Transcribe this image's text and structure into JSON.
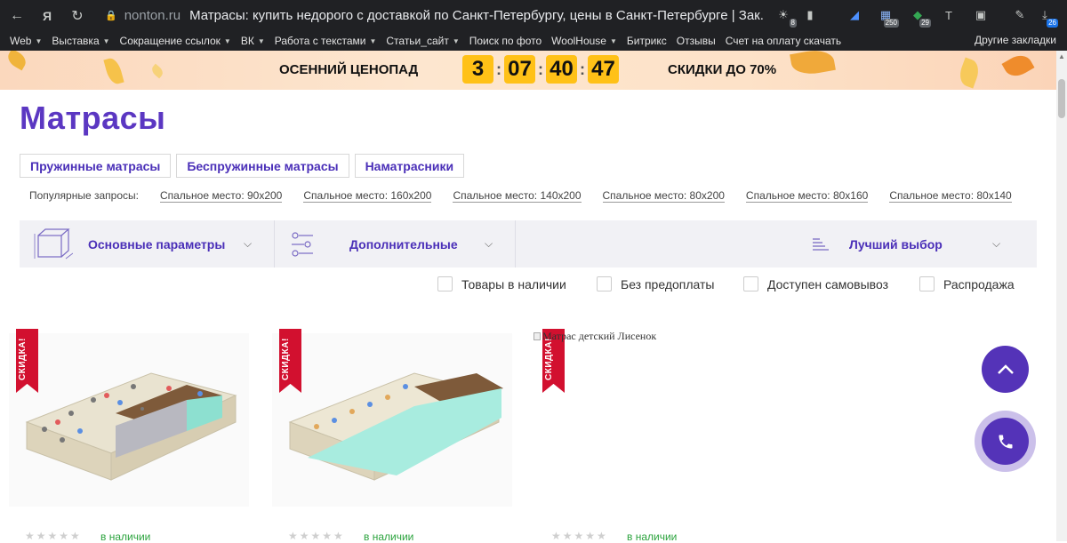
{
  "browser": {
    "domain": "nonton.ru",
    "tab_title": "Матрасы: купить недорого с доставкой по Санкт-Петербургу, цены в Санкт-Петербурге | Зак...",
    "extension_badges": [
      "8",
      "250",
      "29",
      "26"
    ]
  },
  "bookmarks": {
    "items": [
      {
        "label": "Web",
        "dropdown": true
      },
      {
        "label": "Выставка",
        "dropdown": true
      },
      {
        "label": "Сокращение ссылок",
        "dropdown": true
      },
      {
        "label": "ВК",
        "dropdown": true
      },
      {
        "label": "Работа с текстами",
        "dropdown": true
      },
      {
        "label": "Статьи_сайт",
        "dropdown": true
      },
      {
        "label": "Поиск по фото",
        "dropdown": false
      },
      {
        "label": "WoolHouse",
        "dropdown": true
      },
      {
        "label": "Битрикс",
        "dropdown": false
      },
      {
        "label": "Отзывы",
        "dropdown": false
      },
      {
        "label": "Счет на оплату скачать",
        "dropdown": false
      }
    ],
    "other": "Другие закладки"
  },
  "banner": {
    "title": "ОСЕННИЙ ЦЕНОПАД",
    "timer": {
      "days": "3",
      "hours": "07",
      "minutes": "40",
      "seconds": "47"
    },
    "sale": "СКИДКИ ДО 70%"
  },
  "page": {
    "title": "Матрасы",
    "categories": [
      "Пружинные матрасы",
      "Беспружинные матрасы",
      "Наматрасники"
    ],
    "popular_label": "Популярные запросы:",
    "popular_links": [
      "Спальное место: 90х200",
      "Спальное место: 160х200",
      "Спальное место: 140х200",
      "Спальное место: 80х200",
      "Спальное место: 80х160",
      "Спальное место: 80х140"
    ]
  },
  "filters": {
    "main": "Основные параметры",
    "extra": "Дополнительные",
    "sort": "Лучший выбор",
    "checkboxes": [
      "Товары в наличии",
      "Без предоплаты",
      "Доступен самовывоз",
      "Распродажа"
    ]
  },
  "products": [
    {
      "badge": "СКИДКА!",
      "stock": "в наличии",
      "image_alt": ""
    },
    {
      "badge": "СКИДКА!",
      "stock": "в наличии",
      "image_alt": ""
    },
    {
      "badge": "СКИДКА!",
      "stock": "в наличии",
      "image_alt": "Матрас детский Лисенок"
    }
  ],
  "colors": {
    "accent": "#5433b8",
    "title": "#5b37c2",
    "sale_ribbon": "#d2102f",
    "timer": "#ffc117",
    "in_stock": "#2ba33d"
  }
}
